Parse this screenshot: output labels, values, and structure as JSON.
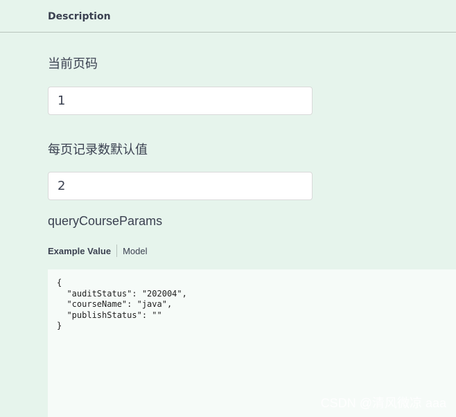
{
  "header": {
    "title": "Description"
  },
  "params": [
    {
      "label": "当前页码",
      "value": "1"
    },
    {
      "label": "每页记录数默认值",
      "value": "2"
    }
  ],
  "body_param": {
    "name": "queryCourseParams",
    "tabs": {
      "example_value": "Example Value",
      "model": "Model"
    },
    "example_json": "{\n  \"auditStatus\": \"202004\",\n  \"courseName\": \"java\",\n  \"publishStatus\": \"\"\n}"
  },
  "watermark": "CSDN @清风微凉 aaa"
}
